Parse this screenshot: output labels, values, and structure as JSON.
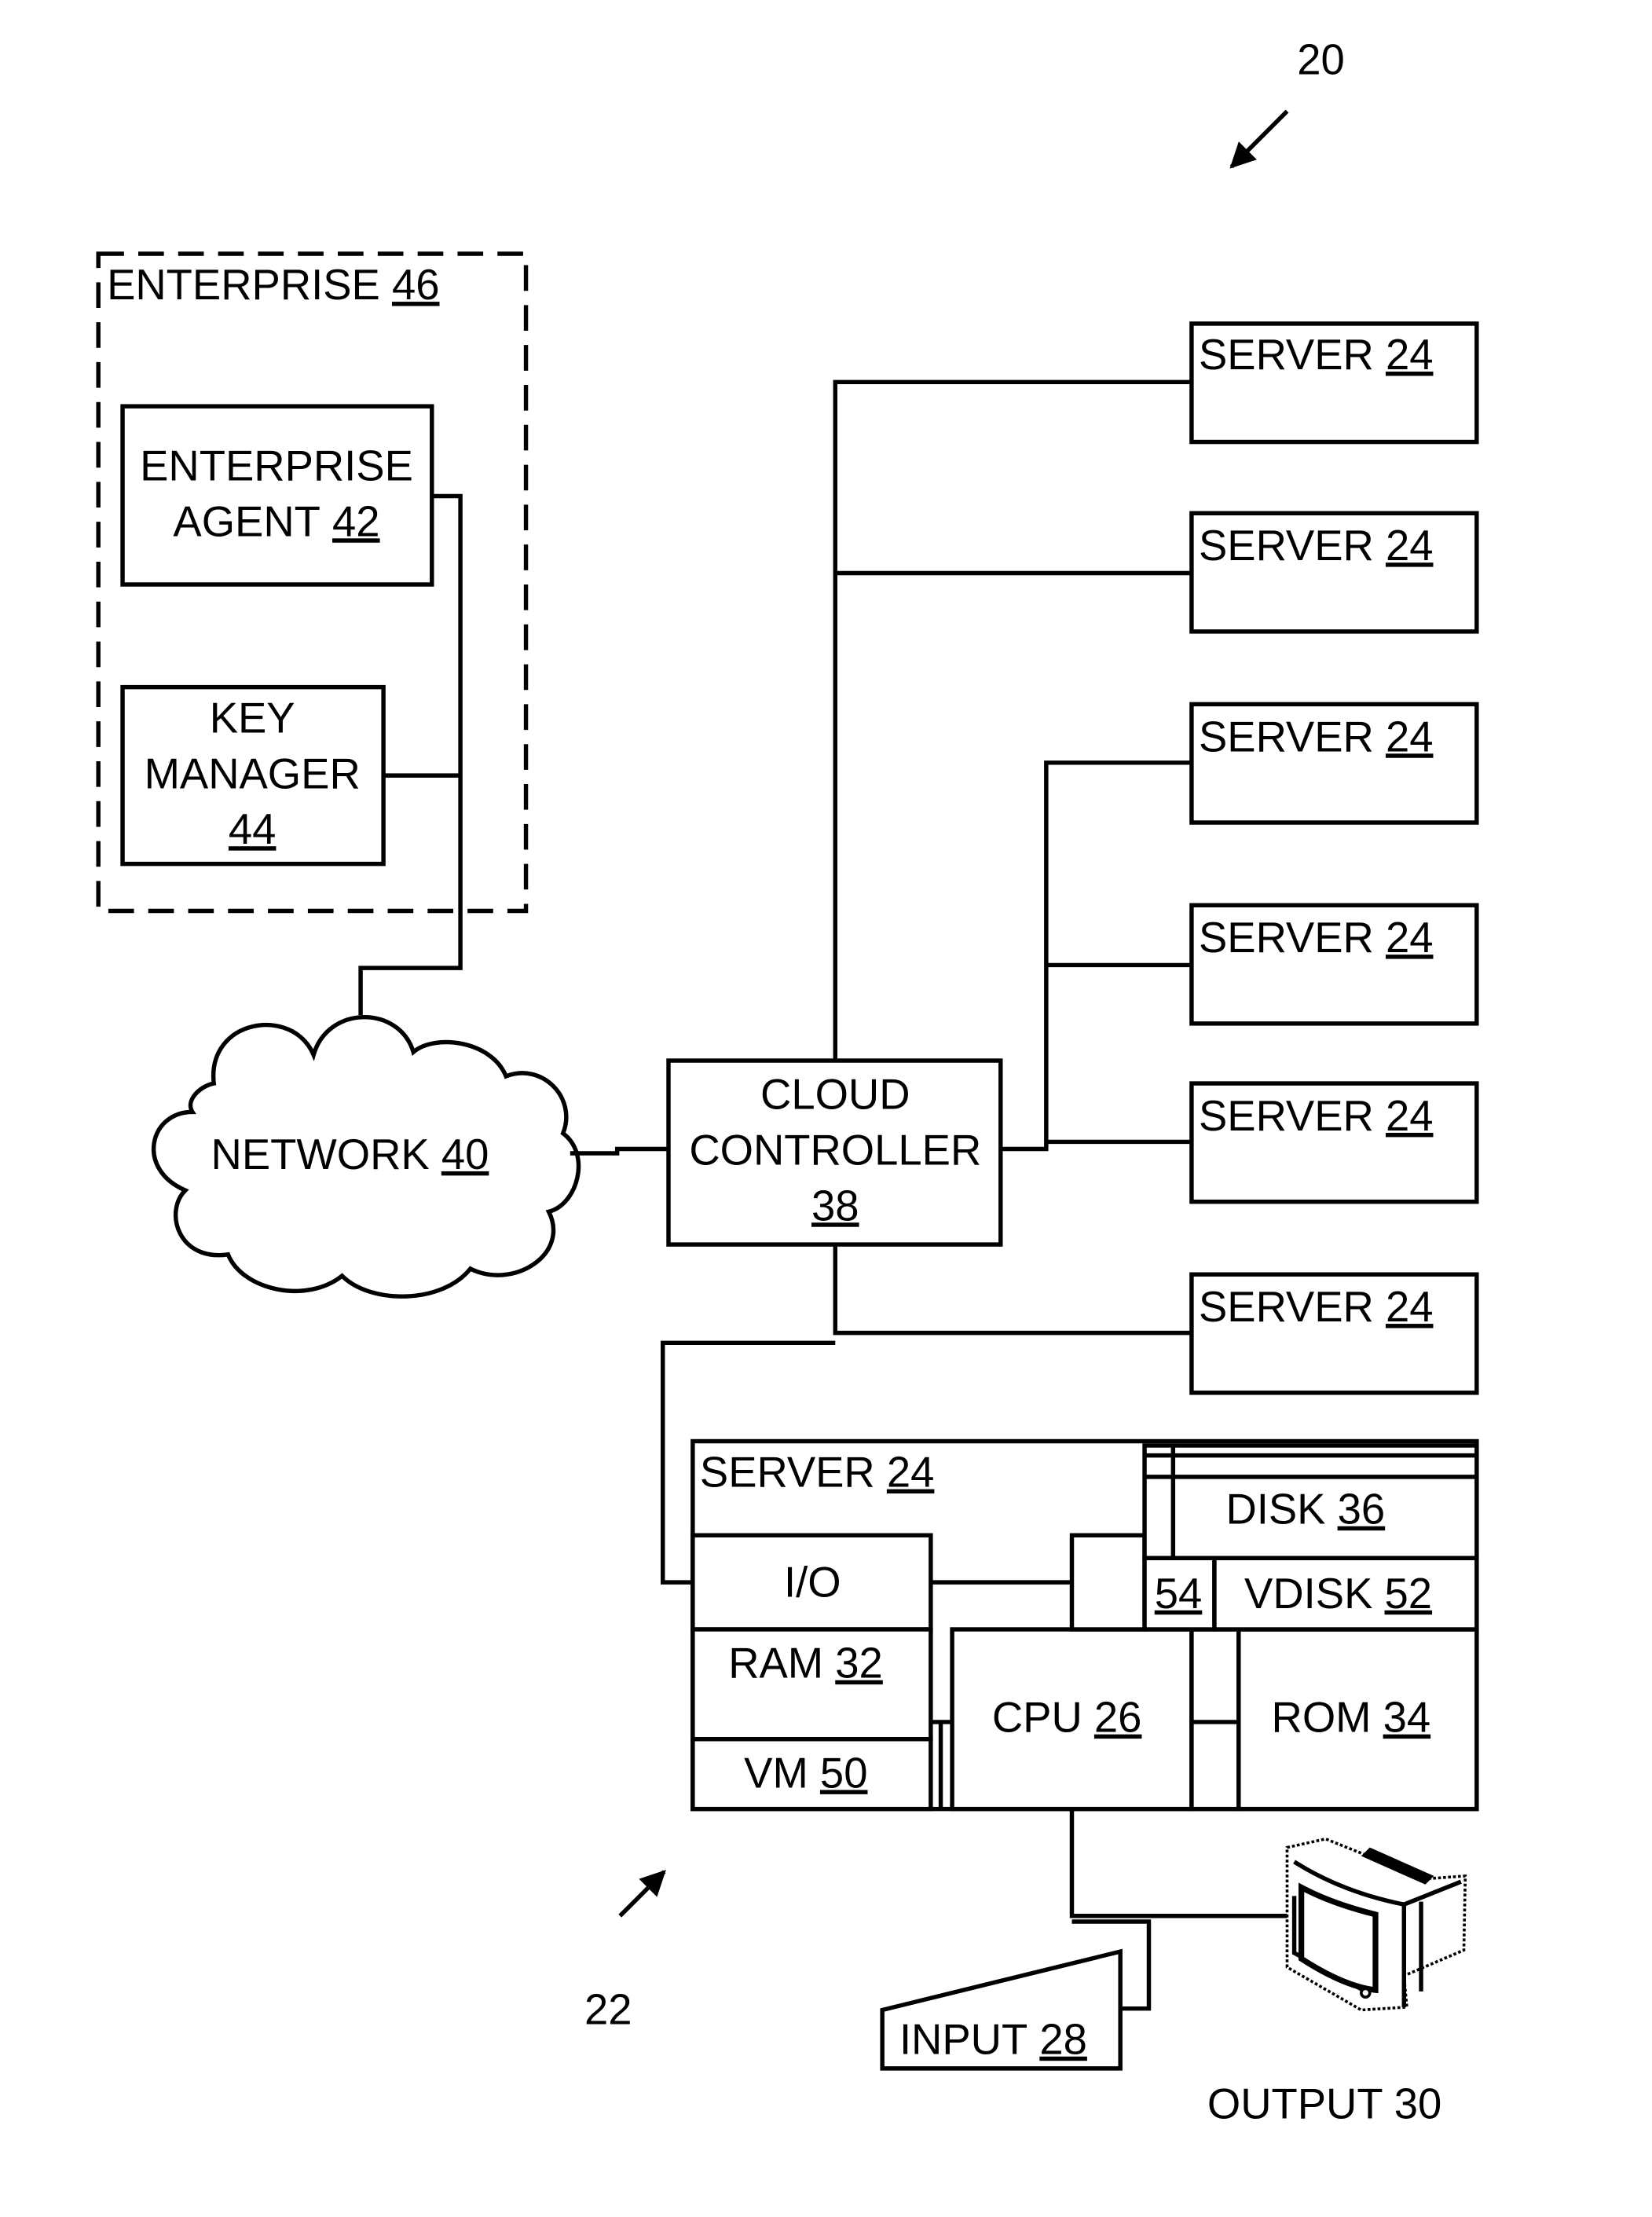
{
  "figure": {
    "ref_system": "20",
    "ref_server_detail": "22"
  },
  "enterprise": {
    "title": "ENTERPRISE",
    "ref": "46",
    "agent": {
      "line1": "ENTERPRISE",
      "line2": "AGENT",
      "ref": "42"
    },
    "key_manager": {
      "line1": "KEY",
      "line2": "MANAGER",
      "ref": "44"
    }
  },
  "network": {
    "label": "NETWORK",
    "ref": "40"
  },
  "cloud_controller": {
    "line1": "CLOUD",
    "line2": "CONTROLLER",
    "ref": "38"
  },
  "servers": [
    {
      "label": "SERVER",
      "ref": "24"
    },
    {
      "label": "SERVER",
      "ref": "24"
    },
    {
      "label": "SERVER",
      "ref": "24"
    },
    {
      "label": "SERVER",
      "ref": "24"
    },
    {
      "label": "SERVER",
      "ref": "24"
    },
    {
      "label": "SERVER",
      "ref": "24"
    }
  ],
  "server_detail": {
    "label": "SERVER",
    "ref": "24",
    "io": {
      "label": "I/O"
    },
    "ram": {
      "label": "RAM",
      "ref": "32"
    },
    "vm": {
      "label": "VM",
      "ref": "50"
    },
    "cpu": {
      "label": "CPU",
      "ref": "26"
    },
    "rom": {
      "label": "ROM",
      "ref": "34"
    },
    "disk": {
      "label": "DISK",
      "ref": "36"
    },
    "vdisk": {
      "label": "VDISK",
      "ref": "52"
    },
    "vdisk_driver": {
      "ref": "54"
    }
  },
  "input": {
    "label": "INPUT",
    "ref": "28"
  },
  "output": {
    "label": "OUTPUT 30"
  }
}
